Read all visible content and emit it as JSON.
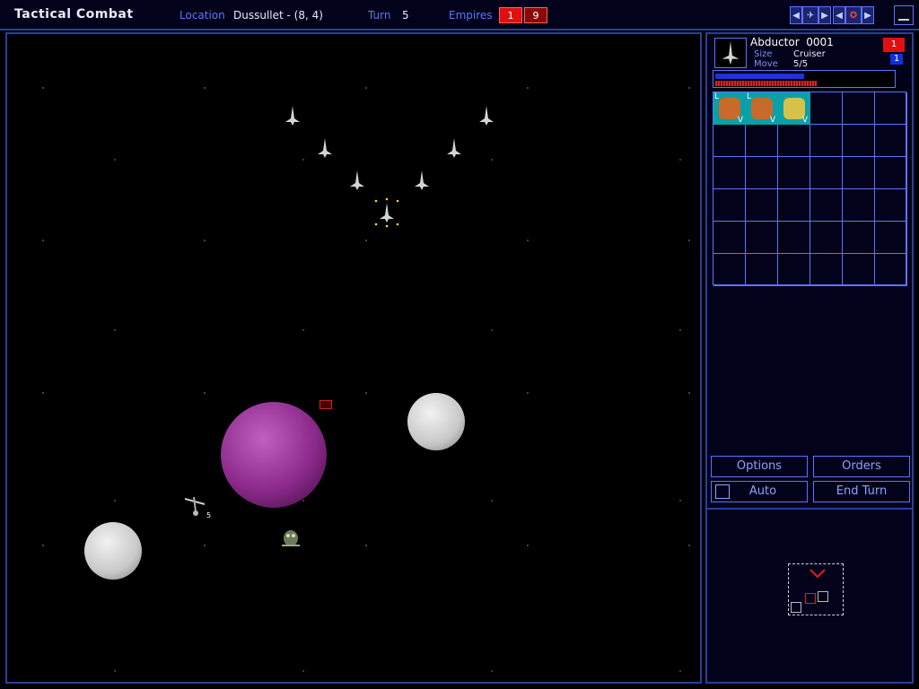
{
  "window": {
    "title": "Tactical Combat",
    "location_label": "Location",
    "location_value": "Dussullet - (8, 4)",
    "turn_label": "Turn",
    "turn_value": "5",
    "empires_label": "Empires",
    "empires": [
      {
        "value": "1",
        "color": "#e01010"
      },
      {
        "value": "9",
        "color": "#8a0a0a"
      }
    ]
  },
  "nav_icons": [
    "prev-arrow-icon",
    "ship-icon",
    "next-arrow-icon",
    "prev-arrow-icon",
    "target-icon",
    "next-arrow-icon"
  ],
  "selected_ship": {
    "name": "Abductor",
    "id": "0001",
    "size_label": "Size",
    "size_value": "Cruiser",
    "move_label": "Move",
    "move_value": "5/5",
    "badge_top": "1",
    "badge_bottom": "1",
    "shield_fraction": 0.5,
    "structure_fraction": 0.57
  },
  "components": [
    {
      "top": "L",
      "bottom": "V",
      "icon": "weapon-component-icon"
    },
    {
      "top": "L",
      "bottom": "V",
      "icon": "weapon-component-icon"
    },
    {
      "top": "",
      "bottom": "V",
      "icon": "engine-component-icon"
    }
  ],
  "buttons": {
    "options": "Options",
    "orders": "Orders",
    "auto": "Auto",
    "end_turn": "End Turn"
  },
  "colors": {
    "accent": "#5c74ff",
    "panel_bg": "#02021a",
    "purple_planet": "#8c2a8c",
    "moon": "#cfcfcf"
  },
  "map_labels": {
    "ship_count": "5"
  }
}
